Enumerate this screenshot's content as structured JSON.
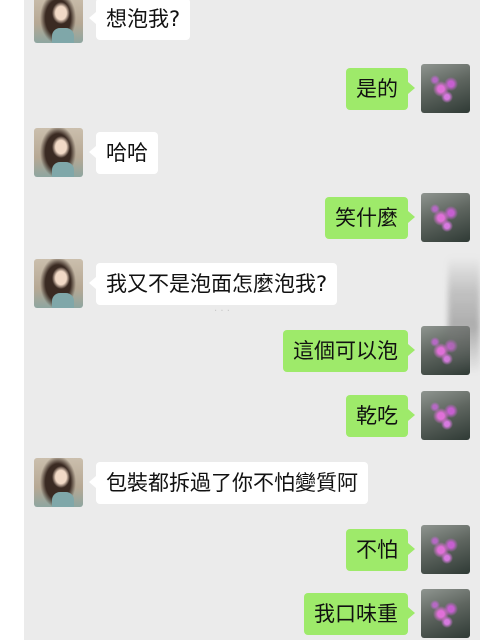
{
  "messages": [
    {
      "side": "left",
      "text": "想泡我?"
    },
    {
      "side": "right",
      "text": "是的"
    },
    {
      "side": "left",
      "text": "哈哈"
    },
    {
      "side": "right",
      "text": "笑什麼"
    },
    {
      "side": "left",
      "text": "我又不是泡面怎麼泡我?"
    },
    {
      "side": "right",
      "text": "這個可以泡"
    },
    {
      "side": "right",
      "text": "乾吃"
    },
    {
      "side": "left",
      "text": "包裝都拆過了你不怕變質阿"
    },
    {
      "side": "right",
      "text": "不怕"
    },
    {
      "side": "right",
      "text": "我口味重"
    }
  ],
  "colors": {
    "background": "#ebebeb",
    "incoming_bubble": "#ffffff",
    "outgoing_bubble": "#9eea6a"
  },
  "icons": {
    "contact_avatar": "girl-avatar",
    "self_avatar": "flower-avatar"
  }
}
